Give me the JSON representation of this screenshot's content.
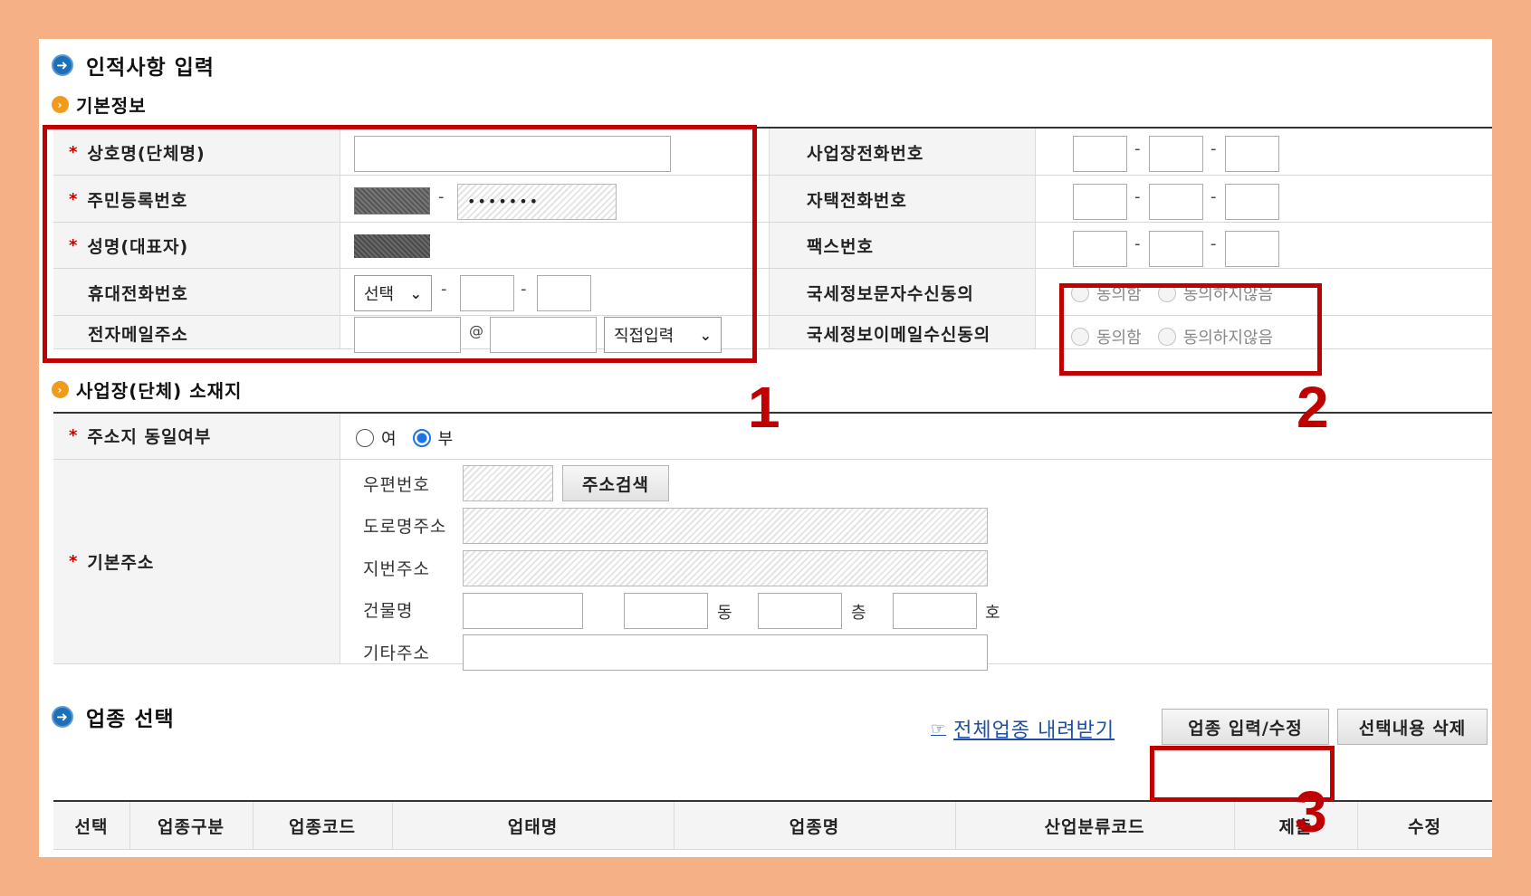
{
  "personal": {
    "title": "인적사항 입력",
    "basic_title": "기본정보",
    "fields": {
      "company_label": "상호명(단체명)",
      "rrn_label": "주민등록번호",
      "rrn_masked": "•••••••",
      "name_label": "성명(대표자)",
      "mobile_label": "휴대전화번호",
      "mobile_select": "선택",
      "email_label": "전자메일주소",
      "email_at": "@",
      "email_select": "직접입력",
      "biz_phone_label": "사업장전화번호",
      "home_phone_label": "자택전화번호",
      "fax_label": "팩스번호",
      "sms_consent_label": "국세정보문자수신동의",
      "email_consent_label": "국세정보이메일수신동의",
      "consent_yes": "동의함",
      "consent_no": "동의하지않음",
      "dash": "-"
    }
  },
  "address": {
    "title": "사업장(단체) 소재지",
    "same_label": "주소지 동일여부",
    "same_yes": "여",
    "same_no": "부",
    "same_selected": "부",
    "base_label": "기본주소",
    "zip_label": "우편번호",
    "search_button": "주소검색",
    "road_label": "도로명주소",
    "lot_label": "지번주소",
    "building_label": "건물명",
    "dong_unit": "동",
    "floor_unit": "층",
    "ho_unit": "호",
    "etc_label": "기타주소"
  },
  "industry": {
    "title": "업종 선택",
    "download_link": "전체업종 내려받기",
    "edit_button": "업종 입력/수정",
    "delete_button": "선택내용 삭제",
    "columns": [
      "선택",
      "업종구분",
      "업종코드",
      "업태명",
      "업종명",
      "산업분류코드",
      "제출",
      "수정"
    ]
  },
  "annotations": {
    "one": "1",
    "two": "2",
    "three": "3"
  },
  "colors": {
    "frame": "#f5b185",
    "annotation_red": "#c00000",
    "heading_blue": "#1d6fb8",
    "sub_orange": "#f29a1c",
    "link_blue": "#1f4fa0"
  }
}
